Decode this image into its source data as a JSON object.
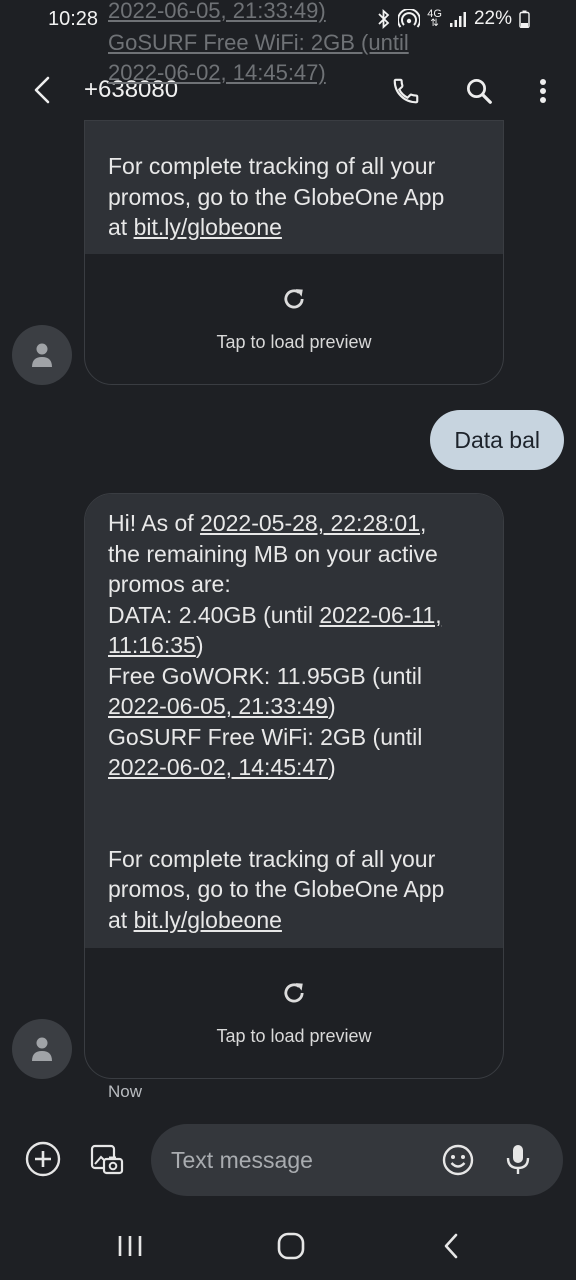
{
  "status_bar": {
    "time": "10:28",
    "network": "4G",
    "battery": "22%"
  },
  "scroll_ghost": {
    "line1": "2022-06-05, 21:33:49)",
    "line2": "GoSURF Free WiFi: 2GB (until",
    "line3": "2022-06-02, 14:45:47)"
  },
  "header": {
    "contact": "+638080"
  },
  "messages": {
    "first": {
      "lines": [
        "For complete tracking of all your",
        "promos, go to the GlobeOne App"
      ],
      "link_prefix": "at ",
      "link": "bit.ly/globeone",
      "preview_label": "Tap to load preview"
    },
    "sent": {
      "text": "Data bal"
    },
    "second": {
      "intro": "Hi! As of ",
      "as_of": "2022-05-28, 22:28:01",
      "intro_tail": ",",
      "line2": "the remaining MB on your active",
      "line3": "promos are:",
      "data_prefix": "DATA: 2.40GB (until ",
      "data_date": "2022-06-11,",
      "data_time": "11:16:35",
      "close": ")",
      "gowork_prefix": "Free GoWORK: 11.95GB (until",
      "gowork_date": "2022-06-05, 21:33:49",
      "gosurf_prefix": "GoSURF Free WiFi: 2GB (until",
      "gosurf_date": "2022-06-02, 14:45:47",
      "track1": "For complete tracking of all your",
      "track2": "promos, go to the GlobeOne App",
      "link_prefix": "at ",
      "link": "bit.ly/globeone",
      "preview_label": "Tap to load preview"
    },
    "timestamp": "Now"
  },
  "compose": {
    "placeholder": "Text message"
  },
  "icons": {
    "back": "back-arrow-icon",
    "call": "phone-icon",
    "search": "search-icon",
    "more": "more-vert-icon",
    "avatar": "person-icon",
    "reload": "refresh-icon",
    "add": "add-circle-icon",
    "gallery": "gallery-camera-icon",
    "emoji": "emoji-icon",
    "mic": "mic-icon",
    "recents": "recents-icon",
    "home": "home-icon",
    "nav_back": "nav-back-icon"
  },
  "colors": {
    "background": "#1e2024",
    "incoming_bubble": "#2f3237",
    "outgoing_bubble": "#c7d4df"
  }
}
